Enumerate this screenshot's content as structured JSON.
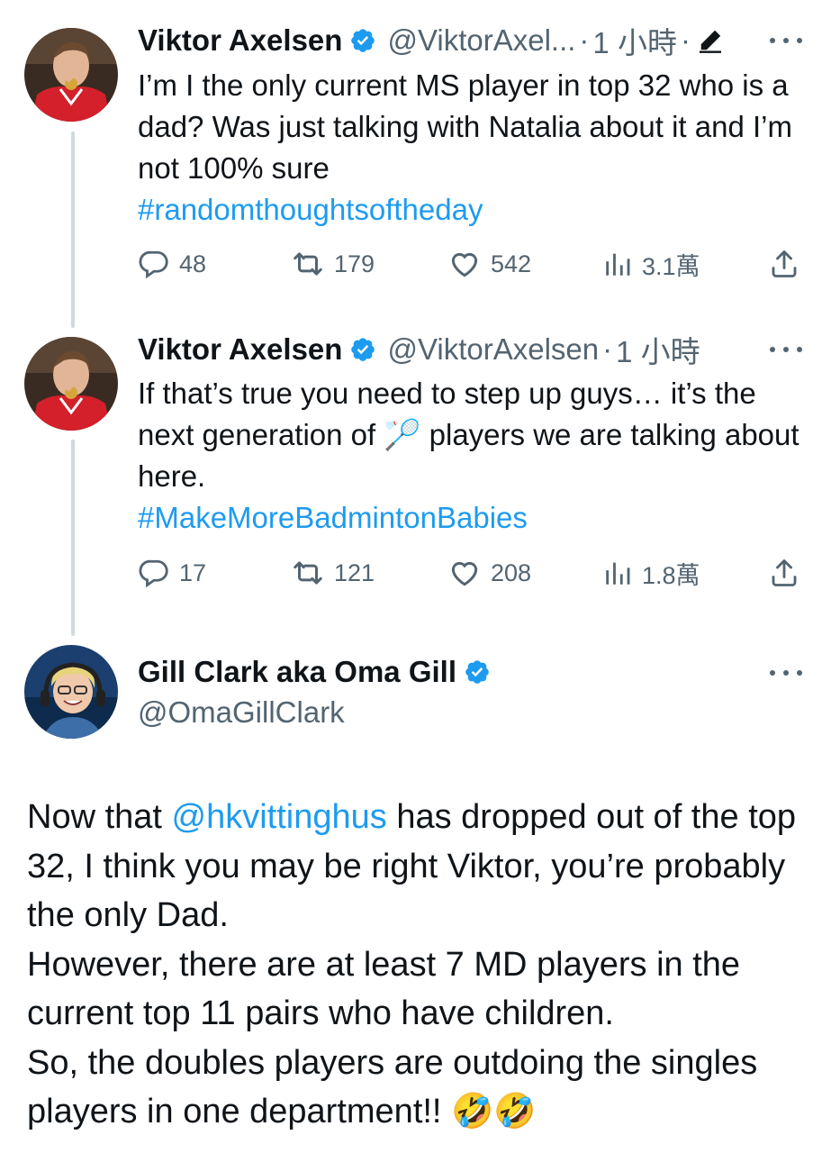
{
  "tweets": [
    {
      "name": "Viktor Axelsen",
      "handle": "@ViktorAxel...",
      "dot": "·",
      "time": "1 小時",
      "edited_dot": "·",
      "text": "I’m I the only current MS player in top 32 who is a dad? Was just talking with Natalia about it and I’m not 100% sure",
      "hashtag": "#randomthoughtsoftheday",
      "replies": "48",
      "retweets": "179",
      "likes": "542",
      "views": "3.1萬"
    },
    {
      "name": "Viktor Axelsen",
      "handle": "@ViktorAxelsen",
      "dot": "·",
      "time": "1 小時",
      "text_1": "If that’s true you need to step up guys… it’s the next generation of",
      "emoji": "🏸",
      "text_2": "players we are talking about here.",
      "hashtag": "#MakeMoreBadmintonBabies",
      "replies": "17",
      "retweets": "121",
      "likes": "208",
      "views": "1.8萬"
    },
    {
      "name": "Gill Clark aka Oma Gill",
      "handle": "@OmaGillClark",
      "text_prefix": "Now that ",
      "mention": "@hkvittinghus",
      "text_suffix": " has dropped out of the top 32, I think you may be right Viktor, you’re probably the only Dad.",
      "text_line2": "However, there are at least 7 MD players in the current top 11 pairs who have children.",
      "text_line3": "So, the doubles players are outdoing the singles players in one department!! 🤣🤣"
    }
  ],
  "colors": {
    "accent": "#1d9bf0",
    "text": "#0f1419",
    "secondary": "#536471",
    "thread_line": "#cfd9de"
  },
  "icons": {
    "verified": "verified-badge-icon",
    "edit": "edit-pencil-icon",
    "more": "more-dots-icon",
    "reply": "reply-bubble-icon",
    "retweet": "retweet-icon",
    "like": "heart-icon",
    "views": "views-bar-chart-icon",
    "share": "share-upload-icon"
  }
}
